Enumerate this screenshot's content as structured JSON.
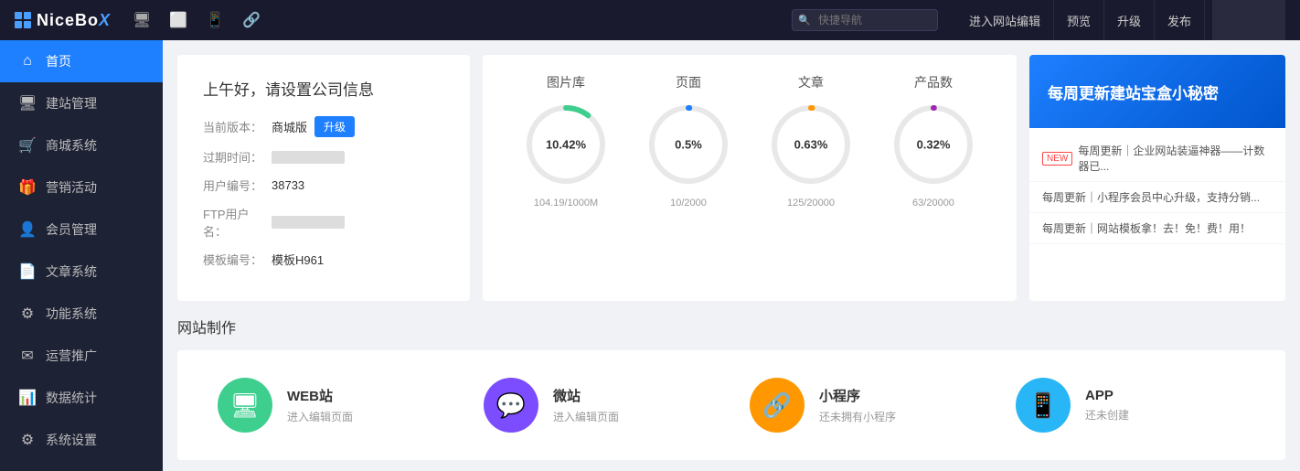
{
  "topbar": {
    "logo_text": "NiceBoX",
    "search_placeholder": "快捷导航",
    "btn_editor": "进入网站编辑",
    "btn_preview": "预览",
    "btn_upgrade": "升级",
    "btn_publish": "发布"
  },
  "sidebar": {
    "items": [
      {
        "id": "home",
        "label": "首页",
        "icon": "⌂",
        "active": true
      },
      {
        "id": "site-mgmt",
        "label": "建站管理",
        "icon": "🖥",
        "active": false
      },
      {
        "id": "shop",
        "label": "商城系统",
        "icon": "📧",
        "active": false
      },
      {
        "id": "marketing",
        "label": "营销活动",
        "icon": "🎁",
        "active": false
      },
      {
        "id": "members",
        "label": "会员管理",
        "icon": "👤",
        "active": false
      },
      {
        "id": "articles",
        "label": "文章系统",
        "icon": "📄",
        "active": false
      },
      {
        "id": "functions",
        "label": "功能系统",
        "icon": "⚙",
        "active": false
      },
      {
        "id": "marketing2",
        "label": "运营推广",
        "icon": "✉",
        "active": false
      },
      {
        "id": "stats",
        "label": "数据统计",
        "icon": "📊",
        "active": false
      },
      {
        "id": "settings",
        "label": "系统设置",
        "icon": "⚙",
        "active": false
      }
    ]
  },
  "info_card": {
    "greeting": "上午好，请设置公司信息",
    "version_label": "当前版本：",
    "version_val": "商城版",
    "upgrade_btn": "升级",
    "expire_label": "过期时间：",
    "user_no_label": "用户编号：",
    "user_no_val": "38733",
    "ftp_label": "FTP用户名：",
    "template_label": "模板编号：",
    "template_val": "模板H961"
  },
  "stats": [
    {
      "label": "图片库",
      "pct_text": "10.42%",
      "sub": "104.19/1000M",
      "color": "#3ecf8e",
      "pct": 10.42
    },
    {
      "label": "页面",
      "pct_text": "0.5%",
      "sub": "10/2000",
      "color": "#1e7fff",
      "pct": 0.5
    },
    {
      "label": "文章",
      "pct_text": "0.63%",
      "sub": "125/20000",
      "color": "#ff9800",
      "pct": 0.63
    },
    {
      "label": "产品数",
      "pct_text": "0.32%",
      "sub": "63/20000",
      "color": "#9c27b0",
      "pct": 0.32
    }
  ],
  "banner": {
    "title": "每周更新建站宝盒小秘密",
    "items": [
      {
        "tag": "NEW",
        "text": "每周更新｜企业网站装逼神器——计数器已..."
      },
      {
        "tag": "",
        "text": "每周更新｜小程序会员中心升级，支持分销..."
      },
      {
        "tag": "",
        "text": "每周更新｜网站模板拿！去！免！费！用！"
      }
    ]
  },
  "creation": {
    "section_title": "网站制作",
    "items": [
      {
        "label": "WEB站",
        "desc": "进入编辑页面",
        "icon_class": "icon-web",
        "icon": "🖥"
      },
      {
        "label": "微站",
        "desc": "进入编辑页面",
        "icon_class": "icon-wechat",
        "icon": "💬"
      },
      {
        "label": "小程序",
        "desc": "还未拥有小程序",
        "icon_class": "icon-mini",
        "icon": "⛓"
      },
      {
        "label": "APP",
        "desc": "还未创建",
        "icon_class": "icon-app",
        "icon": "📱"
      }
    ]
  }
}
